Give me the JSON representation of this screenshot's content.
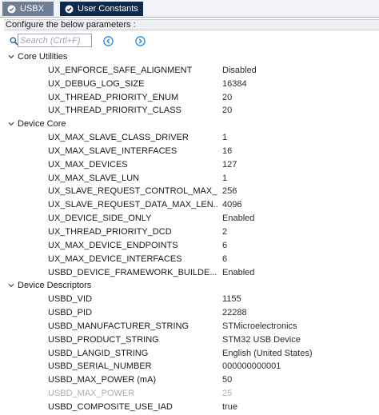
{
  "tabs": [
    {
      "label": "USBX",
      "icon": "check-circle-icon",
      "active": false
    },
    {
      "label": "User Constants",
      "icon": "check-circle-icon",
      "active": true
    }
  ],
  "header": {
    "text": "Configure the below parameters :"
  },
  "search": {
    "placeholder": "Search (Crtl+F)",
    "value": ""
  },
  "groups": [
    {
      "label": "Core Utilities",
      "expanded": true,
      "params": [
        {
          "name": "UX_ENFORCE_SAFE_ALIGNMENT",
          "value": "Disabled",
          "disabled": false
        },
        {
          "name": "UX_DEBUG_LOG_SIZE",
          "value": "16384",
          "disabled": false
        },
        {
          "name": "UX_THREAD_PRIORITY_ENUM",
          "value": "20",
          "disabled": false
        },
        {
          "name": "UX_THREAD_PRIORITY_CLASS",
          "value": "20",
          "disabled": false
        }
      ]
    },
    {
      "label": "Device Core",
      "expanded": true,
      "params": [
        {
          "name": "UX_MAX_SLAVE_CLASS_DRIVER",
          "value": "1",
          "disabled": false
        },
        {
          "name": "UX_MAX_SLAVE_INTERFACES",
          "value": "16",
          "disabled": false
        },
        {
          "name": "UX_MAX_DEVICES",
          "value": "127",
          "disabled": false
        },
        {
          "name": "UX_MAX_SLAVE_LUN",
          "value": "1",
          "disabled": false
        },
        {
          "name": "UX_SLAVE_REQUEST_CONTROL_MAX_...",
          "value": "256",
          "disabled": false
        },
        {
          "name": "UX_SLAVE_REQUEST_DATA_MAX_LEN...",
          "value": "4096",
          "disabled": false
        },
        {
          "name": "UX_DEVICE_SIDE_ONLY",
          "value": "Enabled",
          "disabled": false
        },
        {
          "name": "UX_THREAD_PRIORITY_DCD",
          "value": "2",
          "disabled": false
        },
        {
          "name": "UX_MAX_DEVICE_ENDPOINTS",
          "value": "6",
          "disabled": false
        },
        {
          "name": "UX_MAX_DEVICE_INTERFACES",
          "value": "6",
          "disabled": false
        },
        {
          "name": "USBD_DEVICE_FRAMEWORK_BUILDE...",
          "value": "Enabled",
          "disabled": false
        }
      ]
    },
    {
      "label": "Device Descriptors",
      "expanded": true,
      "params": [
        {
          "name": "USBD_VID",
          "value": "1155",
          "disabled": false
        },
        {
          "name": "USBD_PID",
          "value": "22288",
          "disabled": false
        },
        {
          "name": "USBD_MANUFACTURER_STRING",
          "value": "STMicroelectronics",
          "disabled": false
        },
        {
          "name": "USBD_PRODUCT_STRING",
          "value": "STM32 USB Device",
          "disabled": false
        },
        {
          "name": "USBD_LANGID_STRING",
          "value": "English (United States)",
          "disabled": false
        },
        {
          "name": "USBD_SERIAL_NUMBER",
          "value": "000000000001",
          "disabled": false
        },
        {
          "name": "USBD_MAX_POWER (mA)",
          "value": "50",
          "disabled": false
        },
        {
          "name": "USBD_MAX_POWER",
          "value": "25",
          "disabled": true
        },
        {
          "name": "USBD_COMPOSITE_USE_IAD",
          "value": "true",
          "disabled": false
        }
      ]
    }
  ],
  "colors": {
    "tab_inactive": "#6e7f95",
    "tab_active": "#0e2a4c",
    "nav_button": "#1f7fd6",
    "disabled_text": "#a9adb3"
  }
}
